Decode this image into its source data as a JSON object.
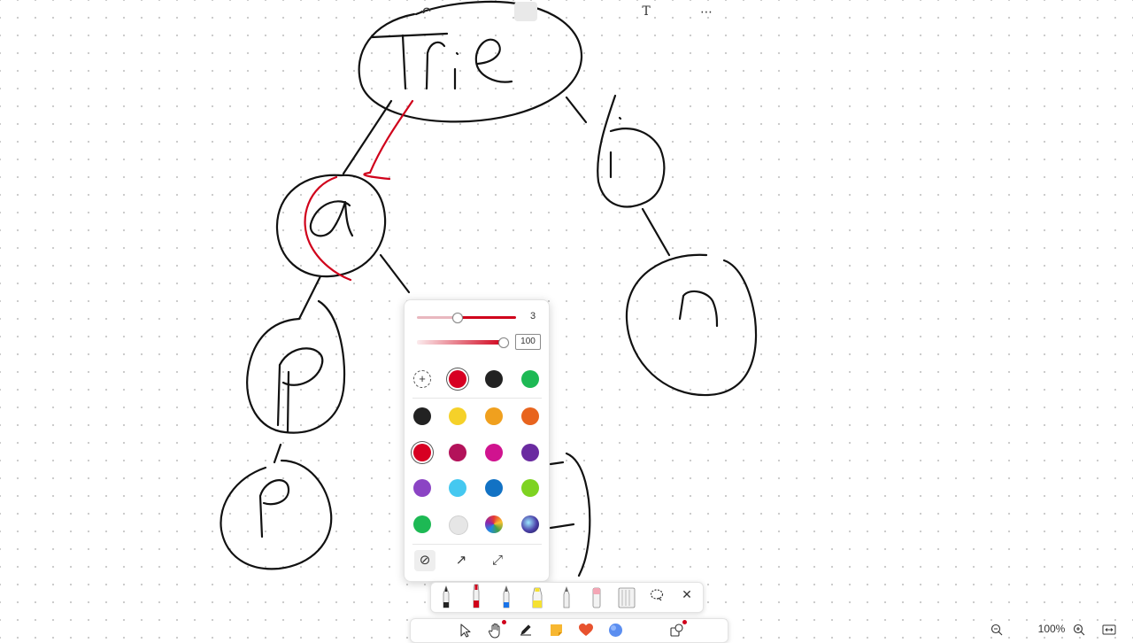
{
  "canvas": {
    "ink_color": "#111111",
    "annotation_color": "#d0021b",
    "text_strokes": [
      "Trie"
    ]
  },
  "pen_settings": {
    "size_value": "3",
    "opacity_value": "100",
    "active_color": "#d0021b",
    "add_color_symbol": "+",
    "recent_colors": [
      "#d70022",
      "#222222",
      "#1db954"
    ],
    "palette": [
      [
        "#222222",
        "#f5d129",
        "#f0a01e",
        "#e8641e"
      ],
      [
        "#d70022",
        "#b3125a",
        "#d0138f",
        "#6a2ba0"
      ],
      [
        "#8b44c4",
        "#45c8f0",
        "#1272c4",
        "#7ed321"
      ],
      [
        "#1db954",
        "#e6e6e6",
        "rainbow",
        "galaxy"
      ]
    ],
    "tips": [
      {
        "name": "no-arrow",
        "glyph": "⊘",
        "active": true
      },
      {
        "name": "arrow-end",
        "glyph": "↗",
        "active": false
      },
      {
        "name": "arrow-both",
        "glyph": "⤢",
        "active": false
      }
    ]
  },
  "pen_toolbar": {
    "tools": [
      "ballpoint-pen",
      "felt-marker",
      "fountain-pen",
      "highlighter",
      "pencil",
      "eraser",
      "ruler",
      "lasso"
    ],
    "close_symbol": "✕"
  },
  "main_toolbar": {
    "undo": "↶",
    "text_tool": "T",
    "more": "⋯"
  },
  "zoom": {
    "zoom_out": "−",
    "value": "100%",
    "zoom_in": "+",
    "fit": "⇔"
  }
}
